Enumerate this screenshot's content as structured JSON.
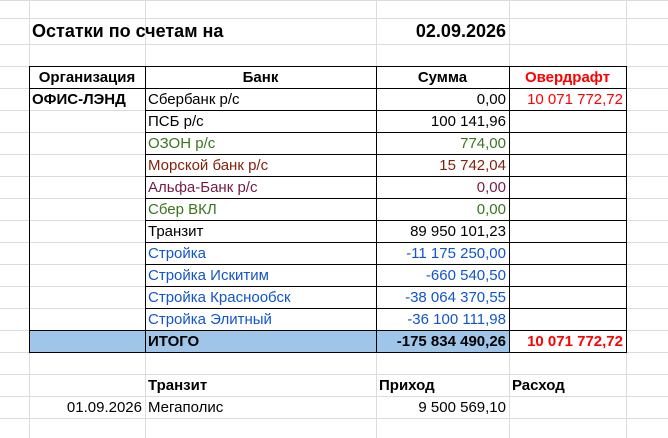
{
  "report": {
    "title": "Остатки по счетам на",
    "date": "02.09.2026"
  },
  "table": {
    "headers": {
      "organization": "Организация",
      "bank": "Банк",
      "amount": "Сумма",
      "overdraft": "Овердрафт"
    },
    "organization": "ОФИС-ЛЭНД",
    "rows": [
      {
        "bank": "Сбербанк р/с",
        "amount": "0,00",
        "overdraft": "10 071 772,72",
        "color": "#000000"
      },
      {
        "bank": "ПСБ р/с",
        "amount": "100 141,96",
        "overdraft": "",
        "color": "#000000"
      },
      {
        "bank": "ОЗОН р/с",
        "amount": "774,00",
        "overdraft": "",
        "color": "#38761d"
      },
      {
        "bank": "Морской банк р/с",
        "amount": "15 742,04",
        "overdraft": "",
        "color": "#85200c"
      },
      {
        "bank": "Альфа-Банк р/с",
        "amount": "0,00",
        "overdraft": "",
        "color": "#741b47"
      },
      {
        "bank": "Сбер ВКЛ",
        "amount": "0,00",
        "overdraft": "",
        "color": "#38761d"
      },
      {
        "bank": "Транзит",
        "amount": "89 950 101,23",
        "overdraft": "",
        "color": "#000000"
      },
      {
        "bank": "Стройка",
        "amount": "-11 175 250,00",
        "overdraft": "",
        "color": "#1155cc"
      },
      {
        "bank": "Стройка Искитим",
        "amount": "-660 540,50",
        "overdraft": "",
        "color": "#1155cc"
      },
      {
        "bank": "Стройка Краснообск",
        "amount": "-38 064 370,55",
        "overdraft": "",
        "color": "#1155cc"
      },
      {
        "bank": "Стройка Элитный",
        "amount": "-36 100 111,98",
        "overdraft": "",
        "color": "#1155cc"
      }
    ],
    "total": {
      "label": "ИТОГО",
      "amount": "-175 834 490,26",
      "overdraft": "10 071 772,72"
    }
  },
  "transit": {
    "headers": {
      "title": "Транзит",
      "income": "Приход",
      "expense": "Расход"
    },
    "rows": [
      {
        "date": "01.09.2026",
        "name": "Мегаполис",
        "income": "9 500 569,10",
        "expense": ""
      }
    ]
  },
  "colors": {
    "overdraft": "#ff0000",
    "total_band": "#9fc5e8",
    "gridline": "#dadce0"
  }
}
